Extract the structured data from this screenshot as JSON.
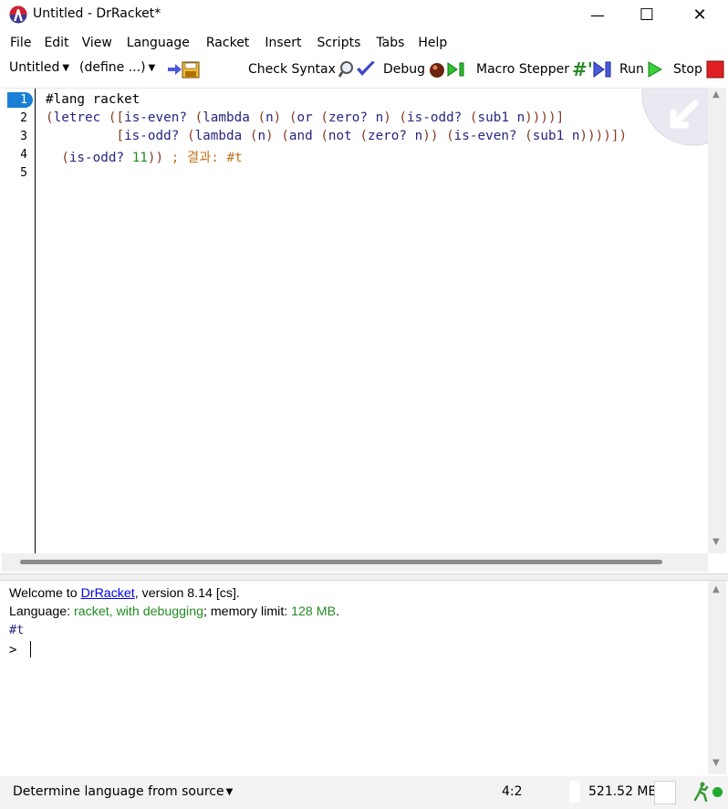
{
  "window": {
    "title": "Untitled - DrRacket*",
    "minimize": "—",
    "maximize": "☐",
    "close": "✕"
  },
  "menu": [
    "File",
    "Edit",
    "View",
    "Language",
    "Racket",
    "Insert",
    "Scripts",
    "Tabs",
    "Help"
  ],
  "toolbar": {
    "file_label": "Untitled",
    "define_label": "(define ...)",
    "check_syntax": "Check Syntax",
    "debug": "Debug",
    "macro_stepper": "Macro Stepper",
    "run": "Run",
    "stop": "Stop"
  },
  "editor": {
    "line_numbers": [
      "1",
      "2",
      "3",
      "4",
      "5"
    ],
    "lines": [
      "#lang racket",
      "(letrec ([is-even? (lambda (n) (or (zero? n) (is-odd? (sub1 n))))]",
      "         [is-odd? (lambda (n) (and (not (zero? n)) (is-even? (sub1 n))))])",
      "  (is-odd? 11)) ; 결과: #t",
      ""
    ]
  },
  "repl": {
    "welcome_prefix": "Welcome to ",
    "welcome_link": "DrRacket",
    "welcome_suffix": ", version 8.14 [cs].",
    "language_prefix": "Language: ",
    "language_value": "racket, with debugging",
    "language_mid": "; memory limit: ",
    "memory_limit": "128 MB",
    "language_end": ".",
    "result": "#t",
    "prompt": ">"
  },
  "status": {
    "language_selector": "Determine language from source",
    "position": "4:2",
    "memory": "521.52 MB"
  },
  "colors": {
    "keyword": "#262680",
    "paren": "#843c24",
    "number": "#228b22",
    "comment": "#c2741f",
    "green_text": "#228b22",
    "link": "#0000ee"
  }
}
